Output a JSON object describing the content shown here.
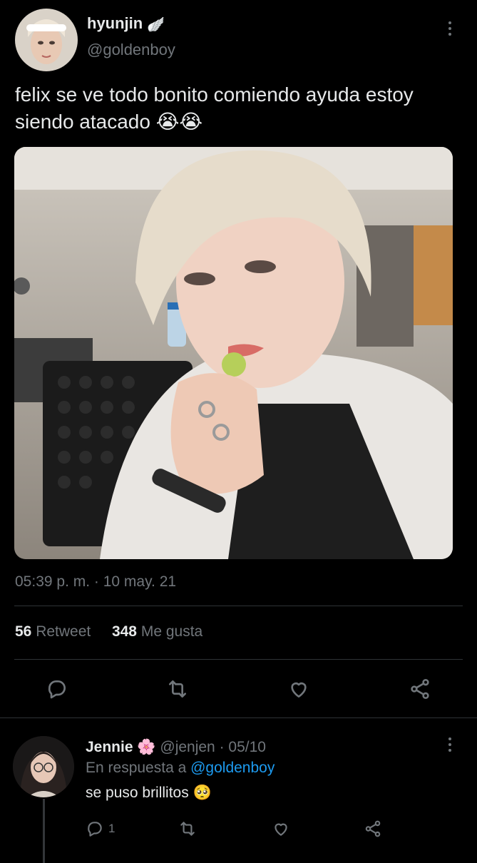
{
  "tweet": {
    "author_name": "hyunjin",
    "author_badge": "🪽",
    "author_handle": "@goldenboy",
    "text": "felix se ve todo bonito comiendo ayuda estoy siendo atacado 😭😭",
    "timestamp": "05:39 p. m. · 10 may. 21",
    "retweets": "56",
    "retweets_label": "Retweet",
    "likes": "348",
    "likes_label": "Me gusta"
  },
  "reply": {
    "name": "Jennie",
    "badge": "🌸",
    "handle_date": "@jenjen · 05/10",
    "reply_prefix": "En respuesta a",
    "reply_to": "@goldenboy",
    "text": "se puso brillitos 🥺",
    "reply_count": "1"
  },
  "icons": [
    "more-vertical-icon",
    "reply-icon",
    "retweet-icon",
    "like-icon",
    "share-icon"
  ],
  "colors": {
    "background": "#000000",
    "text": "#e7e9ea",
    "muted": "#71767b",
    "link": "#1d9bf0",
    "divider": "#2f3336"
  }
}
